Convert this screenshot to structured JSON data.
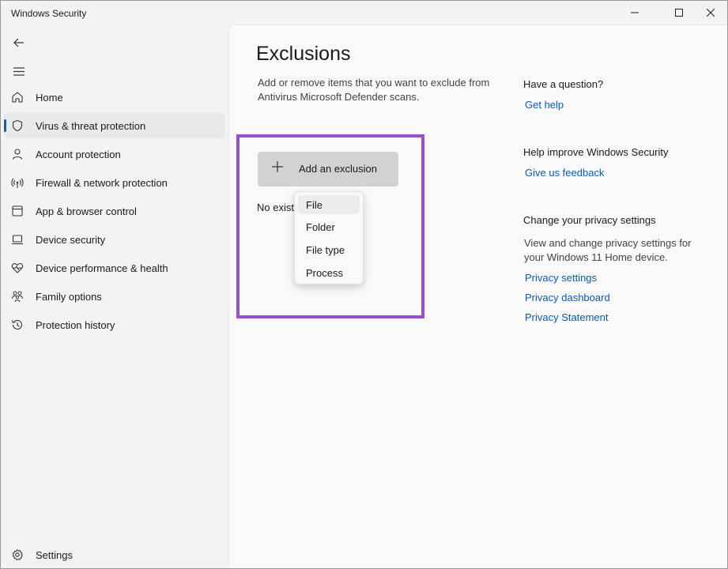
{
  "window": {
    "title": "Windows Security",
    "controls": [
      "minimize-icon",
      "maximize-icon",
      "close-icon"
    ]
  },
  "sidebar": {
    "back_icon": "back-arrow-icon",
    "menu_icon": "hamburger-icon",
    "items": [
      {
        "label": "Home",
        "icon": "home-icon",
        "active": false
      },
      {
        "label": "Virus & threat protection",
        "icon": "shield-icon",
        "active": true
      },
      {
        "label": "Account protection",
        "icon": "person-icon",
        "active": false
      },
      {
        "label": "Firewall & network protection",
        "icon": "wifi-icon",
        "active": false
      },
      {
        "label": "App & browser control",
        "icon": "app-window-icon",
        "active": false
      },
      {
        "label": "Device security",
        "icon": "laptop-icon",
        "active": false
      },
      {
        "label": "Device performance & health",
        "icon": "heart-pulse-icon",
        "active": false
      },
      {
        "label": "Family options",
        "icon": "family-icon",
        "active": false
      },
      {
        "label": "Protection history",
        "icon": "history-icon",
        "active": false
      }
    ],
    "settings_label": "Settings"
  },
  "main": {
    "title": "Exclusions",
    "description": "Add or remove items that you want to exclude from Antivirus Microsoft Defender scans.",
    "add_button_label": "Add an exclusion",
    "no_items_text": "No exist",
    "dropdown_items": [
      "File",
      "Folder",
      "File type",
      "Process"
    ],
    "highlight_color": "#9a4fd0"
  },
  "right_panel": {
    "question_heading": "Have a question?",
    "get_help_link": "Get help",
    "improve_heading": "Help improve Windows Security",
    "feedback_link": "Give us feedback",
    "privacy_heading": "Change your privacy settings",
    "privacy_text": "View and change privacy settings for your Windows 11 Home device.",
    "privacy_links": [
      "Privacy settings",
      "Privacy dashboard",
      "Privacy Statement"
    ]
  },
  "colors": {
    "accent": "#1a5bb8",
    "link": "#0a5bb5",
    "highlight": "#9a4fd0"
  }
}
